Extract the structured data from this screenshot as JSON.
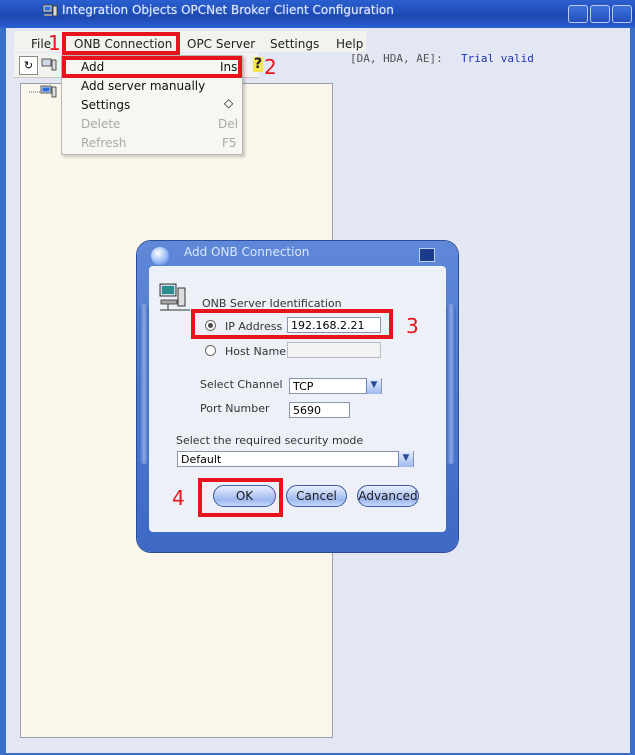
{
  "window": {
    "title": "Integration Objects OPCNet Broker Client Configuration"
  },
  "menubar": {
    "items": [
      {
        "label": "File"
      },
      {
        "label": "ONB Connection"
      },
      {
        "label": "OPC Server"
      },
      {
        "label": "Settings"
      },
      {
        "label": "Help"
      }
    ]
  },
  "toolbar": {
    "help_glyph": "?"
  },
  "status": {
    "prefix": "[DA, HDA, AE]:",
    "value": "Trial valid"
  },
  "dropdown": {
    "items": [
      {
        "label": "Add",
        "shortcut": "Ins"
      },
      {
        "label": "Add server manually",
        "shortcut": ""
      },
      {
        "label": "Settings",
        "shortcut": "◇"
      },
      {
        "label": "Delete",
        "shortcut": "Del"
      },
      {
        "label": "Refresh",
        "shortcut": "F5"
      }
    ]
  },
  "dialog": {
    "title": "Add ONB Connection",
    "group_label": "ONB Server Identification",
    "ip_label": "IP Address",
    "ip_value": "192.168.2.21",
    "host_label": "Host Name",
    "host_value": "",
    "channel_label": "Select Channel",
    "channel_value": "TCP",
    "port_label": "Port Number",
    "port_value": "5690",
    "security_label": "Select the required  security mode",
    "security_value": "Default",
    "ok_label": "OK",
    "cancel_label": "Cancel",
    "advanced_label": "Advanced"
  },
  "steps": [
    "1",
    "2",
    "3",
    "4"
  ],
  "colors": {
    "highlight_red": "#e8131d",
    "title_blue": "#1d49b0",
    "trial_blue": "#1f36b5"
  }
}
